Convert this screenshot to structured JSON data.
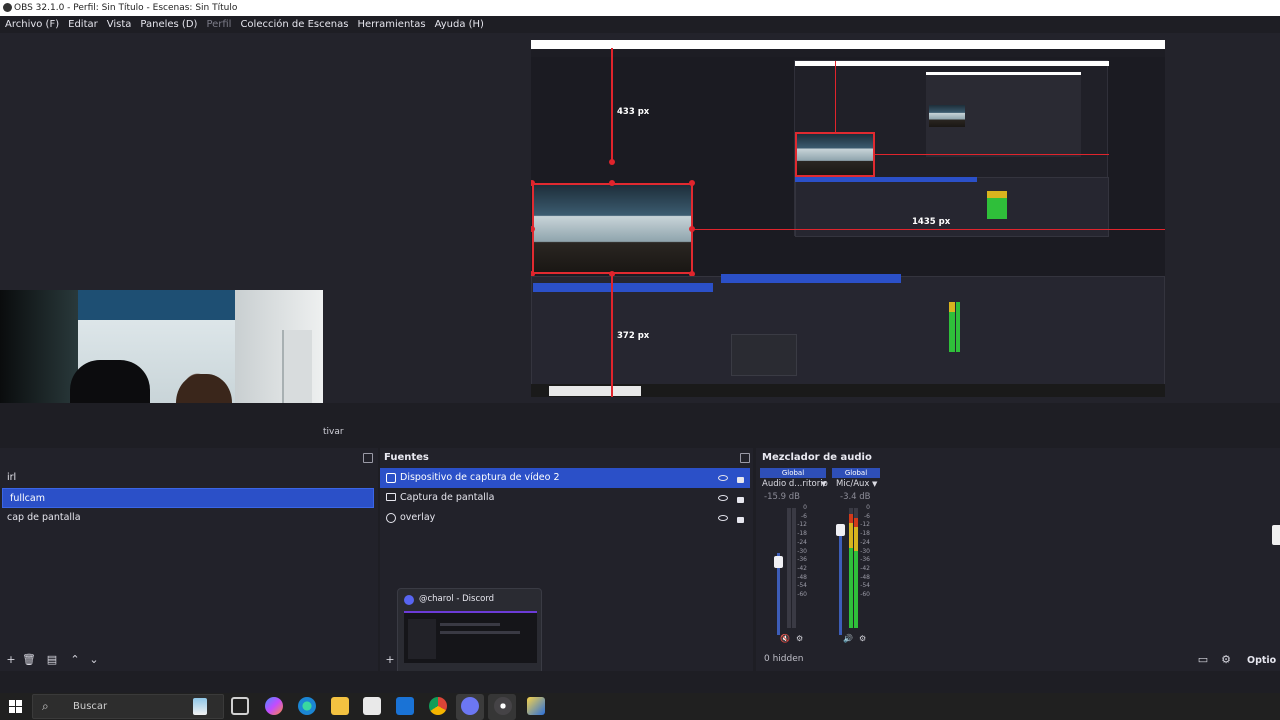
{
  "window": {
    "title": "OBS 32.1.0 - Perfil: Sin Título - Escenas: Sin Título"
  },
  "menu": [
    {
      "label": "Archivo (F)",
      "dim": false
    },
    {
      "label": "Editar",
      "dim": false
    },
    {
      "label": "Vista",
      "dim": false
    },
    {
      "label": "Paneles (D)",
      "dim": false
    },
    {
      "label": "Perfil",
      "dim": true
    },
    {
      "label": "Colección de Escenas",
      "dim": false
    },
    {
      "label": "Herramientas",
      "dim": false
    },
    {
      "label": "Ayuda (H)",
      "dim": false
    }
  ],
  "preview": {
    "measure_top": "433 px",
    "measure_right": "1435 px",
    "measure_bottom": "372 px"
  },
  "controls_partial_label": "tivar",
  "scenes": {
    "items": [
      {
        "label": "irl",
        "selected": false
      },
      {
        "label": "fullcam",
        "selected": true
      },
      {
        "label": "cap de pantalla",
        "selected": false
      }
    ]
  },
  "sources": {
    "title": "Fuentes",
    "items": [
      {
        "label": "Dispositivo de captura de vídeo 2",
        "icon": "camera-icon",
        "selected": true
      },
      {
        "label": "Captura de pantalla",
        "icon": "monitor-icon",
        "selected": false
      },
      {
        "label": "overlay",
        "icon": "globe-icon",
        "selected": false
      }
    ]
  },
  "discord_popup": {
    "title": "@charol - Discord"
  },
  "mixer": {
    "title": "Mezclador de audio",
    "channels": [
      {
        "tag": "Global",
        "name": "Audio d...ritorio",
        "db": "-15.9 dB",
        "level": 0.0
      },
      {
        "tag": "Global",
        "name": "Mic/Aux",
        "db": "-3.4 dB",
        "level": 0.88
      }
    ],
    "scale": [
      "0",
      "-6",
      "-12",
      "-18",
      "-24",
      "-30",
      "-36",
      "-42",
      "-48",
      "-54",
      "-60"
    ],
    "hidden_label": "0 hidden",
    "options_label": "Optio"
  },
  "taskbar": {
    "search_placeholder": "Buscar"
  },
  "colors": {
    "accent": "#2b50c8",
    "red_guide": "#e0242c",
    "meter_green": "#2fbf3a"
  }
}
